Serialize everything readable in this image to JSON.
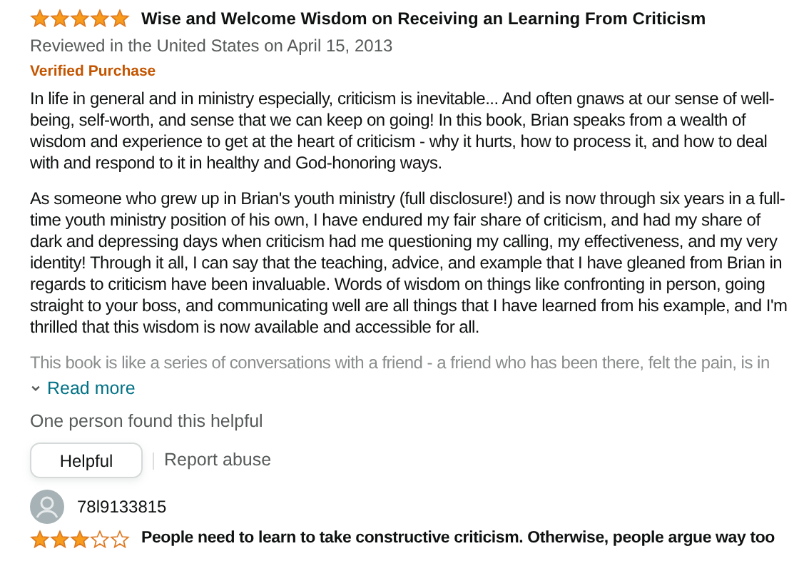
{
  "reviews": [
    {
      "stars": 5,
      "title": "Wise and Welcome Wisdom on Receiving an Learning From Criticism",
      "meta": "Reviewed in the United States on April 15, 2013",
      "badge": "Verified Purchase",
      "paragraphs": [
        "In life in general and in ministry especially, criticism is inevitable... And often gnaws at our sense of well-being, self-worth, and sense that we can keep on going! In this book, Brian speaks from a wealth of wisdom and experience to get at the heart of criticism - why it hurts, how to process it, and how to deal with and respond to it in healthy and God-honoring ways.",
        "As someone who grew up in Brian's youth ministry (full disclosure!) and is now through six years in a full-time youth ministry position of his own, I have endured my fair share of criticism, and had my share of dark and depressing days when criticism had me questioning my calling, my effectiveness, and my very identity! Through it all, I can say that the teaching, advice, and example that I have gleaned from Brian in regards to criticism have been invaluable. Words of wisdom on things like confronting in person, going straight to your boss, and communicating well are all things that I have learned from his example, and I'm thrilled that this wisdom is now available and accessible for all.",
        "This book is like a series of conversations with a friend - a friend who has been there, felt the pain, is in"
      ],
      "read_more": "Read more",
      "helpful_count": "One person found this helpful",
      "helpful_button": "Helpful",
      "report": "Report abuse"
    },
    {
      "author": "78l9133815",
      "stars": 3,
      "title": "People need to learn to take constructive criticism. Otherwise, people argue way too"
    }
  ]
}
